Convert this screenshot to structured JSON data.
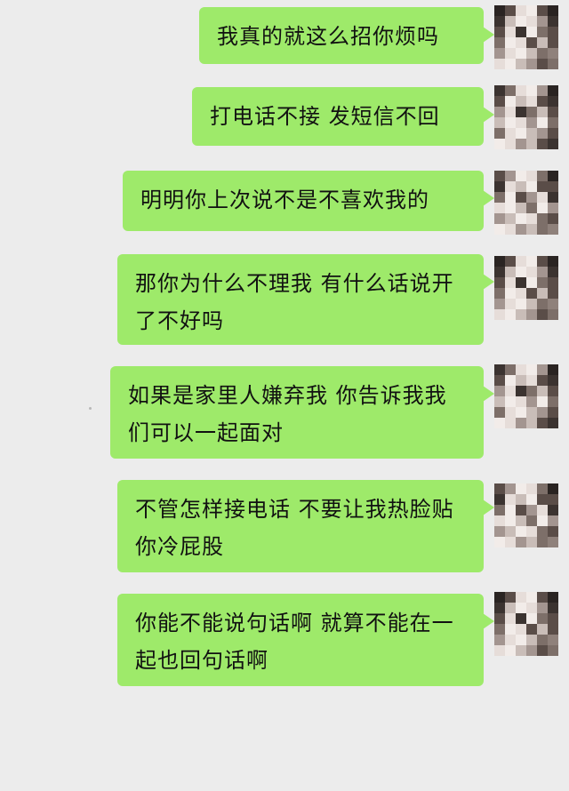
{
  "chat": {
    "messages": [
      {
        "text": "我真的就这么招你烦吗"
      },
      {
        "text": "打电话不接 发短信不回"
      },
      {
        "text": "明明你上次说不是不喜欢我的"
      },
      {
        "text": "那你为什么不理我 有什么话说开了不好吗"
      },
      {
        "text": "如果是家里人嫌弃我 你告诉我我们可以一起面对"
      },
      {
        "text": "不管怎样接电话 不要让我热脸贴你冷屁股"
      },
      {
        "text": "你能不能说句话啊 就算不能在一起也回句话啊"
      }
    ]
  },
  "colors": {
    "background": "#ececec",
    "bubble": "#9eea6a",
    "text": "#111111"
  },
  "icons": {
    "avatar": "pixelated-avatar"
  }
}
